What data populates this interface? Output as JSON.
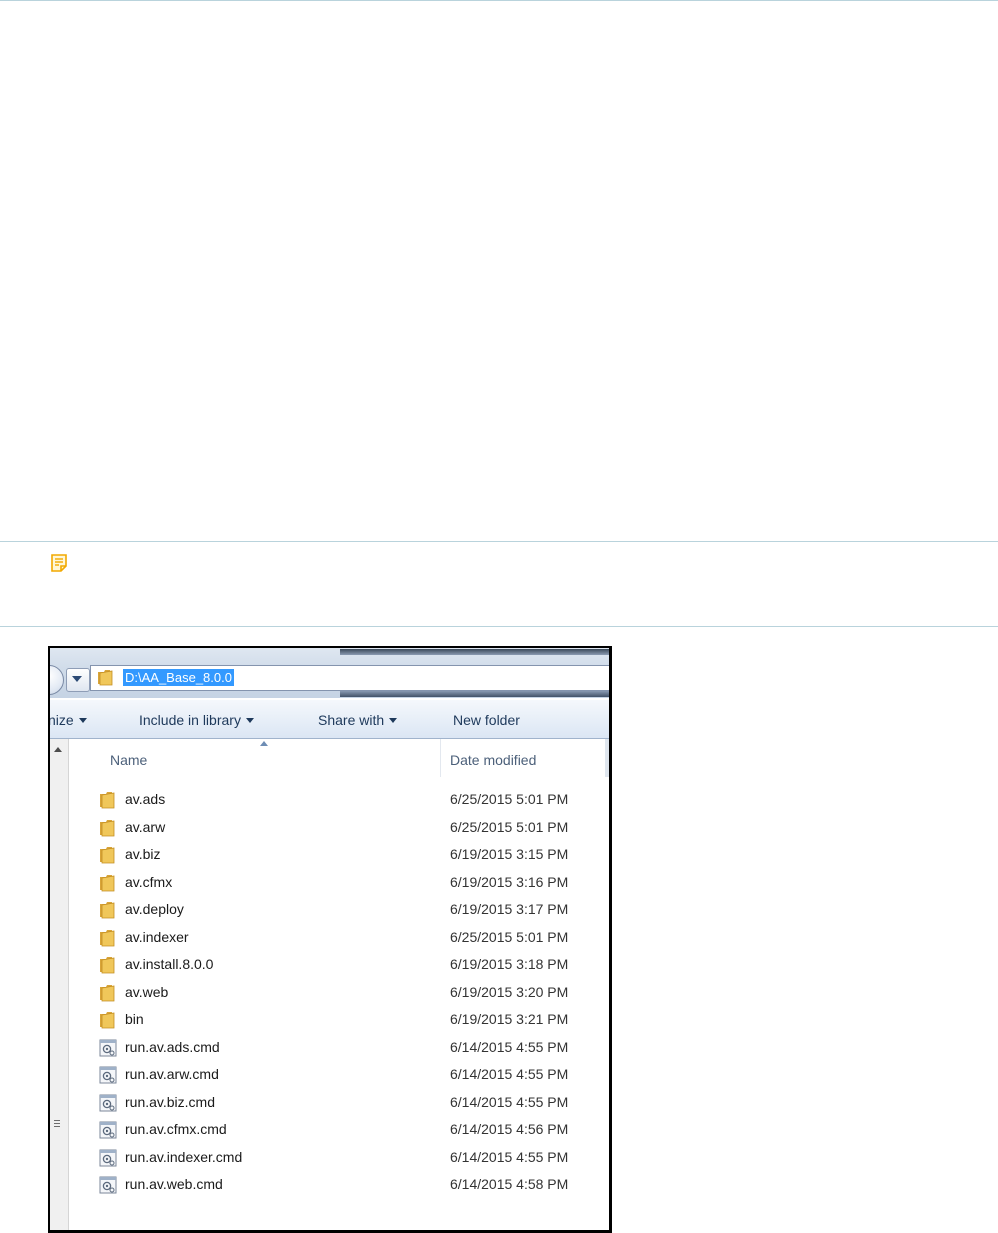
{
  "explorer": {
    "address": "D:\\AA_Base_8.0.0",
    "toolbar": {
      "organize_label": "nize",
      "include_label": "Include in library",
      "share_label": "Share with",
      "new_folder_label": "New folder"
    },
    "columns": {
      "name": "Name",
      "date_modified": "Date modified"
    },
    "files": [
      {
        "name": "av.ads",
        "date": "6/25/2015 5:01 PM",
        "icon": "folder-icon"
      },
      {
        "name": "av.arw",
        "date": "6/25/2015 5:01 PM",
        "icon": "folder-icon"
      },
      {
        "name": "av.biz",
        "date": "6/19/2015 3:15 PM",
        "icon": "folder-icon"
      },
      {
        "name": "av.cfmx",
        "date": "6/19/2015 3:16 PM",
        "icon": "folder-icon"
      },
      {
        "name": "av.deploy",
        "date": "6/19/2015 3:17 PM",
        "icon": "folder-icon"
      },
      {
        "name": "av.indexer",
        "date": "6/25/2015 5:01 PM",
        "icon": "folder-icon"
      },
      {
        "name": "av.install.8.0.0",
        "date": "6/19/2015 3:18 PM",
        "icon": "folder-icon"
      },
      {
        "name": "av.web",
        "date": "6/19/2015 3:20 PM",
        "icon": "folder-icon"
      },
      {
        "name": "bin",
        "date": "6/19/2015 3:21 PM",
        "icon": "folder-icon"
      },
      {
        "name": "run.av.ads.cmd",
        "date": "6/14/2015 4:55 PM",
        "icon": "cmd-file-icon"
      },
      {
        "name": "run.av.arw.cmd",
        "date": "6/14/2015 4:55 PM",
        "icon": "cmd-file-icon"
      },
      {
        "name": "run.av.biz.cmd",
        "date": "6/14/2015 4:55 PM",
        "icon": "cmd-file-icon"
      },
      {
        "name": "run.av.cfmx.cmd",
        "date": "6/14/2015 4:56 PM",
        "icon": "cmd-file-icon"
      },
      {
        "name": "run.av.indexer.cmd",
        "date": "6/14/2015 4:55 PM",
        "icon": "cmd-file-icon"
      },
      {
        "name": "run.av.web.cmd",
        "date": "6/14/2015 4:58 PM",
        "icon": "cmd-file-icon"
      }
    ]
  },
  "colors": {
    "rule": "#b9d3dc",
    "note_icon": "#f2a900",
    "toolbar_text": "#1e395b",
    "selection": "#3399ff",
    "folder": "#e8b94a"
  }
}
